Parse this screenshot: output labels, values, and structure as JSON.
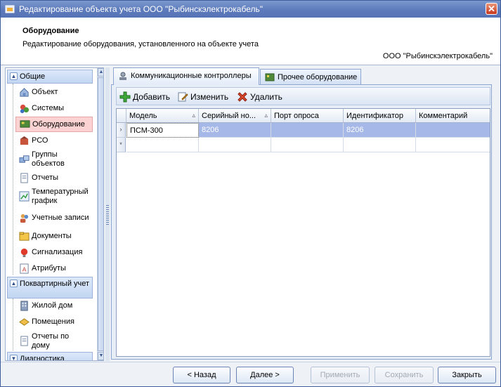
{
  "window": {
    "title": "Редактирование объекта учета ООО \"Рыбинскэлектрокабель\"",
    "close_glyph": "✕"
  },
  "header": {
    "title": "Оборудование",
    "description": "Редактирование оборудования, установленного на объекте учета",
    "organization": "ООО \"Рыбинскэлектрокабель\""
  },
  "sidebar": {
    "groups": [
      {
        "label": "Общие",
        "chevron": "▲"
      },
      {
        "label": "Поквартирный учет",
        "chevron": "▲"
      },
      {
        "label": "Диагностика",
        "chevron": "▼"
      }
    ],
    "items_general": [
      {
        "label": "Объект",
        "icon": "house-icon"
      },
      {
        "label": "Системы",
        "icon": "systems-icon"
      },
      {
        "label": "Оборудование",
        "icon": "equipment-icon"
      },
      {
        "label": "РСО",
        "icon": "rso-icon"
      },
      {
        "label": "Группы объектов",
        "icon": "groups-icon"
      },
      {
        "label": "Отчеты",
        "icon": "report-icon"
      },
      {
        "label": "Температурный график",
        "icon": "chart-icon"
      },
      {
        "label": "Учетные записи",
        "icon": "users-icon"
      },
      {
        "label": "Документы",
        "icon": "documents-icon"
      },
      {
        "label": "Сигнализация",
        "icon": "alarm-icon"
      },
      {
        "label": "Атрибуты",
        "icon": "attributes-icon"
      }
    ],
    "items_apartment": [
      {
        "label": "Жилой дом",
        "icon": "building-icon"
      },
      {
        "label": "Помещения",
        "icon": "rooms-icon"
      },
      {
        "label": "Отчеты по дому",
        "icon": "report-icon"
      }
    ],
    "active_item": "Оборудование"
  },
  "tabs": [
    {
      "label": "Коммуникационные контроллеры",
      "icon": "controller-icon",
      "active": true
    },
    {
      "label": "Прочее оборудование",
      "icon": "board-icon",
      "active": false
    }
  ],
  "toolbar": {
    "add_label": "Добавить",
    "edit_label": "Изменить",
    "delete_label": "Удалить"
  },
  "grid": {
    "columns": [
      {
        "label": "Модель",
        "sortable": true
      },
      {
        "label": "Серийный но...",
        "sortable": true
      },
      {
        "label": "Порт опроса",
        "sortable": false
      },
      {
        "label": "Идентификатор",
        "sortable": false
      },
      {
        "label": "Комментарий",
        "sortable": false
      }
    ],
    "sort_glyph": "▵",
    "rows": [
      {
        "marker": "›",
        "cells": [
          "ПСМ-300",
          "8206",
          "",
          "8206",
          ""
        ]
      }
    ],
    "new_row_marker": "*"
  },
  "buttons": {
    "back": "< Назад",
    "next": "Далее >",
    "apply": "Применить",
    "save": "Сохранить",
    "close": "Закрыть"
  },
  "colors": {
    "title_bar": "#5d7bbc",
    "selection": "#a6b8e8",
    "active_nav": "#fbd3d3"
  }
}
